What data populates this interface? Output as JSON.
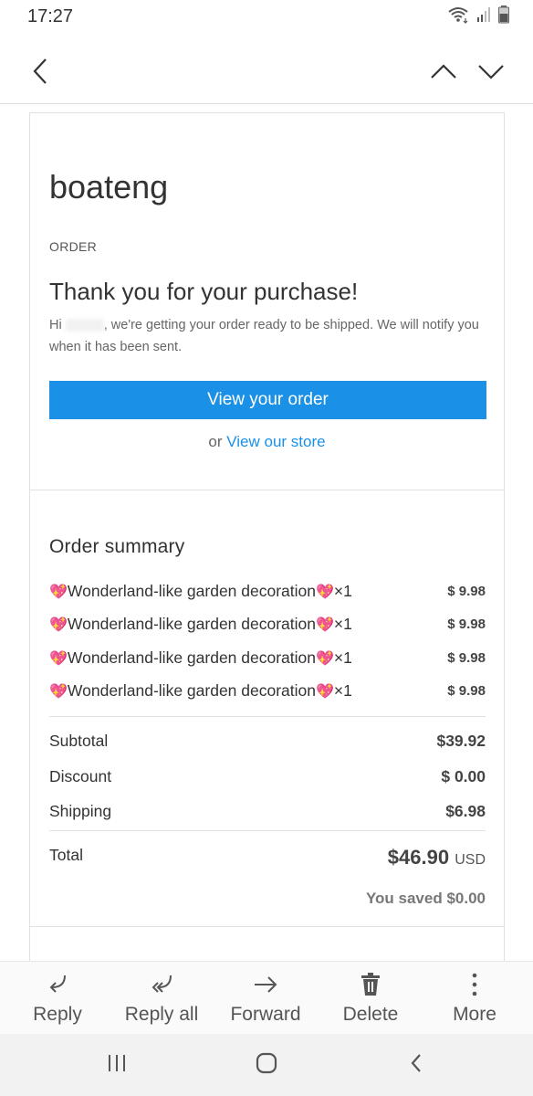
{
  "status_bar": {
    "time": "17:27",
    "icons": [
      "wifi-icon",
      "signal-icon",
      "battery-icon"
    ]
  },
  "app_bar": {
    "back_icon": "chevron-left-icon",
    "prev_icon": "chevron-up-icon",
    "next_icon": "chevron-down-icon"
  },
  "email": {
    "shop_name": "boateng",
    "order_label": "ORDER",
    "thanks": "Thank you for your purchase!",
    "notice_prefix": "Hi",
    "notice_text": ", we're getting your order ready to be shipped. We will notify you when it has been sent.",
    "cta_label": "View your order",
    "or_text": "or",
    "store_link": "View our store",
    "summary_title": "Order summary",
    "items": [
      {
        "name": "Wonderland-like garden decoration",
        "qty": "×1",
        "price": "$ 9.98"
      },
      {
        "name": "Wonderland-like garden decoration",
        "qty": "×1",
        "price": "$ 9.98"
      },
      {
        "name": "Wonderland-like garden decoration",
        "qty": "×1",
        "price": "$ 9.98"
      },
      {
        "name": "Wonderland-like garden decoration",
        "qty": "×1",
        "price": "$ 9.98"
      }
    ],
    "subtotal_label": "Subtotal",
    "subtotal_value": "$39.92",
    "discount_label": "Discount",
    "discount_value": "$ 0.00",
    "shipping_label": "Shipping",
    "shipping_value": "$6.98",
    "total_label": "Total",
    "total_value": "$46.90",
    "total_currency": "USD",
    "saved": "You saved $0.00",
    "accent_color": "#1a90e6"
  },
  "actions": [
    {
      "label": "Reply",
      "icon": "reply-icon"
    },
    {
      "label": "Reply all",
      "icon": "reply-all-icon"
    },
    {
      "label": "Forward",
      "icon": "forward-icon"
    },
    {
      "label": "Delete",
      "icon": "trash-icon"
    },
    {
      "label": "More",
      "icon": "more-vertical-icon"
    }
  ],
  "nav": {
    "recents_icon": "recents-icon",
    "home_icon": "home-icon",
    "back_icon": "back-icon"
  }
}
